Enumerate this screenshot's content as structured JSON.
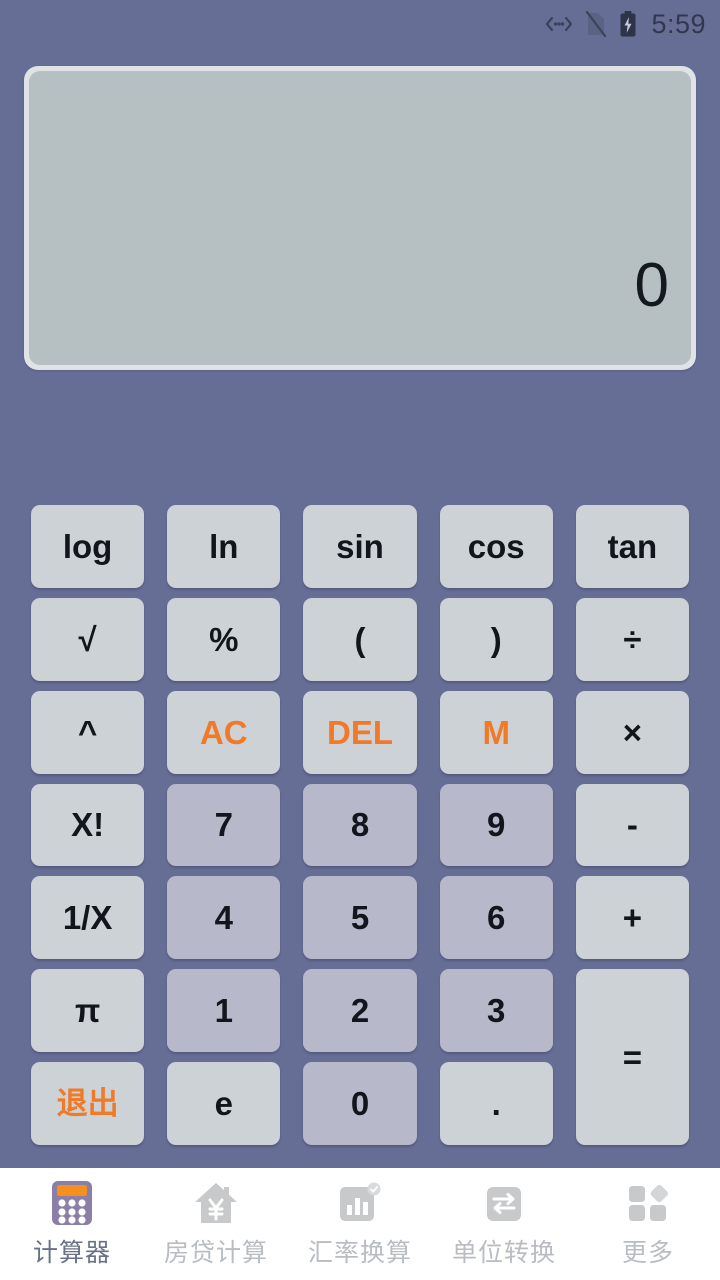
{
  "statusbar": {
    "time": "5:59",
    "icons": [
      "usb-debugging-icon",
      "no-sim-icon",
      "battery-charging-icon"
    ]
  },
  "display": {
    "expression": "",
    "value": "0"
  },
  "colors": {
    "background": "#676e96",
    "display_screen": "#b6c0c3",
    "display_frame": "#dfe3e6",
    "key_function": "#ccd2d6",
    "key_digit": "#b7b9cb",
    "accent_orange": "#f07a28",
    "nav_background": "#ffffff",
    "nav_label_inactive": "#b9bdc2",
    "nav_label_active": "#6b7288"
  },
  "keypad": {
    "rows": [
      [
        {
          "label": "log",
          "type": "function"
        },
        {
          "label": "ln",
          "type": "function"
        },
        {
          "label": "sin",
          "type": "function"
        },
        {
          "label": "cos",
          "type": "function"
        },
        {
          "label": "tan",
          "type": "function"
        }
      ],
      [
        {
          "label": "√",
          "type": "function"
        },
        {
          "label": "%",
          "type": "function"
        },
        {
          "label": "(",
          "type": "function"
        },
        {
          "label": ")",
          "type": "function"
        },
        {
          "label": "÷",
          "type": "function"
        }
      ],
      [
        {
          "label": "^",
          "type": "function"
        },
        {
          "label": "AC",
          "type": "accent"
        },
        {
          "label": "DEL",
          "type": "accent"
        },
        {
          "label": "M",
          "type": "accent"
        },
        {
          "label": "×",
          "type": "function"
        }
      ],
      [
        {
          "label": "X!",
          "type": "function"
        },
        {
          "label": "7",
          "type": "digit"
        },
        {
          "label": "8",
          "type": "digit"
        },
        {
          "label": "9",
          "type": "digit"
        },
        {
          "label": "-",
          "type": "function"
        }
      ],
      [
        {
          "label": "1/X",
          "type": "function"
        },
        {
          "label": "4",
          "type": "digit"
        },
        {
          "label": "5",
          "type": "digit"
        },
        {
          "label": "6",
          "type": "digit"
        },
        {
          "label": "+",
          "type": "function"
        }
      ],
      [
        {
          "label": "π",
          "type": "function"
        },
        {
          "label": "1",
          "type": "digit"
        },
        {
          "label": "2",
          "type": "digit"
        },
        {
          "label": "3",
          "type": "digit"
        },
        {
          "label": "=",
          "type": "equals"
        }
      ],
      [
        {
          "label": "退出",
          "type": "accent-cjk"
        },
        {
          "label": "e",
          "type": "function"
        },
        {
          "label": "0",
          "type": "digit"
        },
        {
          "label": ".",
          "type": "function"
        }
      ]
    ]
  },
  "bottomnav": {
    "items": [
      {
        "label": "计算器",
        "icon": "calculator-icon",
        "active": true
      },
      {
        "label": "房贷计算",
        "icon": "house-yen-icon",
        "active": false
      },
      {
        "label": "汇率换算",
        "icon": "bar-chart-icon",
        "active": false
      },
      {
        "label": "单位转换",
        "icon": "swap-arrows-icon",
        "active": false
      },
      {
        "label": "更多",
        "icon": "grid-more-icon",
        "active": false
      }
    ]
  }
}
